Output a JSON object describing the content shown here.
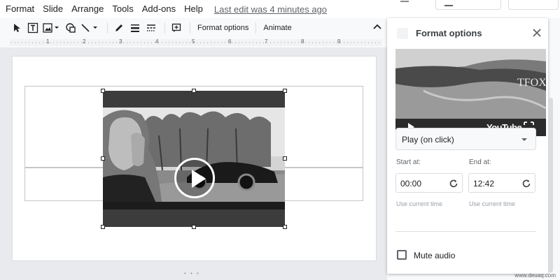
{
  "menubar": {
    "items": [
      "Format",
      "Slide",
      "Arrange",
      "Tools",
      "Add-ons",
      "Help"
    ],
    "last_edit": "Last edit was 4 minutes ago"
  },
  "toolbar": {
    "format_options_label": "Format options",
    "animate_label": "Animate",
    "icons": [
      "select-icon",
      "text-box-icon",
      "image-icon",
      "shape-icon",
      "line-icon",
      "pen-icon",
      "border-weight-icon",
      "border-dash-icon",
      "comment-add-icon",
      "collapse-caret-icon"
    ]
  },
  "ruler": {
    "numbers": [
      "1",
      "2",
      "3",
      "4",
      "5",
      "6",
      "7",
      "8",
      "9"
    ]
  },
  "panel": {
    "title": "Format options",
    "preview": {
      "brand": "YouTube",
      "watermark": "TFOX"
    },
    "playback": {
      "selected": "Play (on click)"
    },
    "start": {
      "label": "Start at:",
      "value": "00:00",
      "hint": "Use current time"
    },
    "end": {
      "label": "End at:",
      "value": "12:42",
      "hint": "Use current time"
    },
    "mute_label": "Mute audio",
    "mute_checked": false
  },
  "watermark_text": "www.deuaq.com"
}
